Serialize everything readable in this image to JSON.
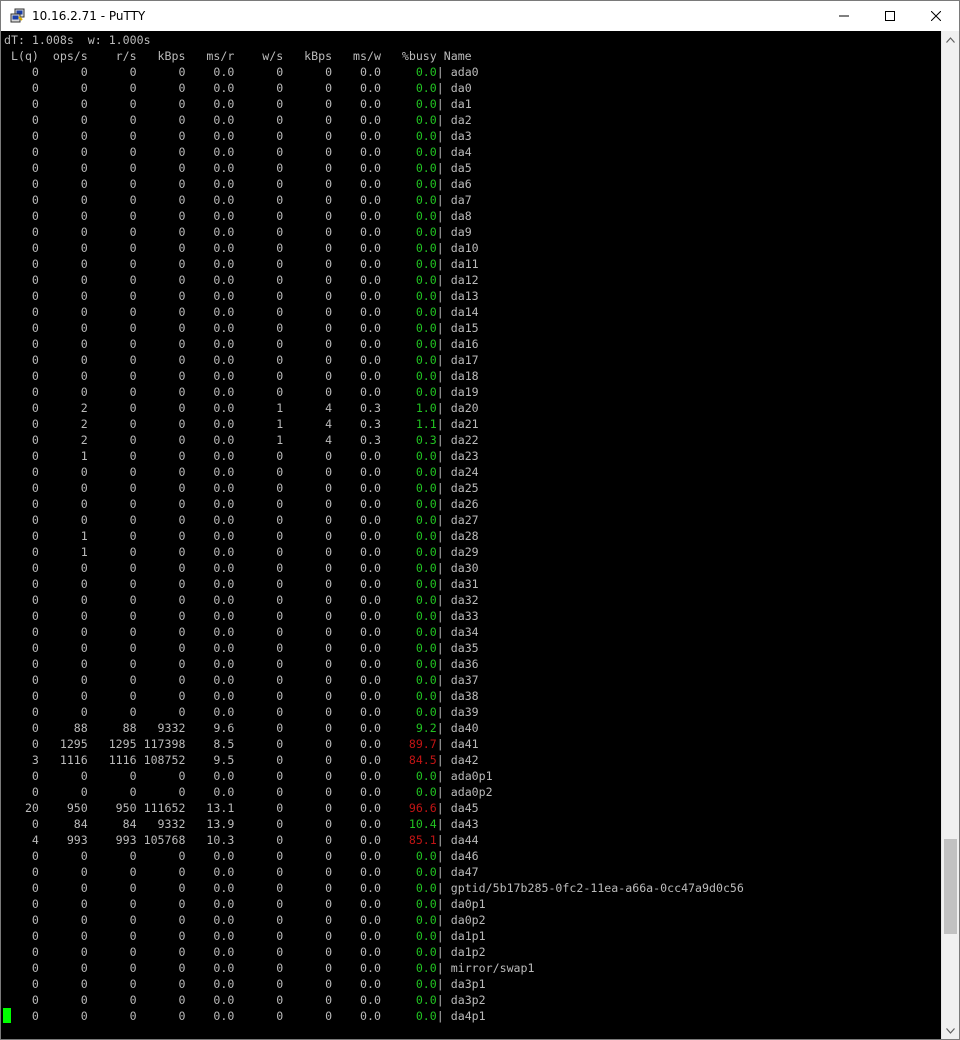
{
  "window": {
    "title": "10.16.2.71 - PuTTY",
    "icon": "putty-icon",
    "controls": [
      "minimize-icon",
      "maximize-icon",
      "close-icon"
    ]
  },
  "terminal": {
    "status_line": "dT: 1.008s  w: 1.000s",
    "columns": [
      "L(q)",
      "ops/s",
      "r/s",
      "kBps",
      "ms/r",
      "w/s",
      "kBps",
      "ms/w",
      "%busy",
      "Name"
    ],
    "colors": {
      "background": "#000000",
      "text": "#bbbbbb",
      "busy_low": "#22c322",
      "busy_high": "#c21414",
      "cursor": "#00ff00"
    },
    "rows": [
      [
        "0",
        "0",
        "0",
        "0",
        "0.0",
        "0",
        "0",
        "0.0",
        "0.0",
        "ada0"
      ],
      [
        "0",
        "0",
        "0",
        "0",
        "0.0",
        "0",
        "0",
        "0.0",
        "0.0",
        "da0"
      ],
      [
        "0",
        "0",
        "0",
        "0",
        "0.0",
        "0",
        "0",
        "0.0",
        "0.0",
        "da1"
      ],
      [
        "0",
        "0",
        "0",
        "0",
        "0.0",
        "0",
        "0",
        "0.0",
        "0.0",
        "da2"
      ],
      [
        "0",
        "0",
        "0",
        "0",
        "0.0",
        "0",
        "0",
        "0.0",
        "0.0",
        "da3"
      ],
      [
        "0",
        "0",
        "0",
        "0",
        "0.0",
        "0",
        "0",
        "0.0",
        "0.0",
        "da4"
      ],
      [
        "0",
        "0",
        "0",
        "0",
        "0.0",
        "0",
        "0",
        "0.0",
        "0.0",
        "da5"
      ],
      [
        "0",
        "0",
        "0",
        "0",
        "0.0",
        "0",
        "0",
        "0.0",
        "0.0",
        "da6"
      ],
      [
        "0",
        "0",
        "0",
        "0",
        "0.0",
        "0",
        "0",
        "0.0",
        "0.0",
        "da7"
      ],
      [
        "0",
        "0",
        "0",
        "0",
        "0.0",
        "0",
        "0",
        "0.0",
        "0.0",
        "da8"
      ],
      [
        "0",
        "0",
        "0",
        "0",
        "0.0",
        "0",
        "0",
        "0.0",
        "0.0",
        "da9"
      ],
      [
        "0",
        "0",
        "0",
        "0",
        "0.0",
        "0",
        "0",
        "0.0",
        "0.0",
        "da10"
      ],
      [
        "0",
        "0",
        "0",
        "0",
        "0.0",
        "0",
        "0",
        "0.0",
        "0.0",
        "da11"
      ],
      [
        "0",
        "0",
        "0",
        "0",
        "0.0",
        "0",
        "0",
        "0.0",
        "0.0",
        "da12"
      ],
      [
        "0",
        "0",
        "0",
        "0",
        "0.0",
        "0",
        "0",
        "0.0",
        "0.0",
        "da13"
      ],
      [
        "0",
        "0",
        "0",
        "0",
        "0.0",
        "0",
        "0",
        "0.0",
        "0.0",
        "da14"
      ],
      [
        "0",
        "0",
        "0",
        "0",
        "0.0",
        "0",
        "0",
        "0.0",
        "0.0",
        "da15"
      ],
      [
        "0",
        "0",
        "0",
        "0",
        "0.0",
        "0",
        "0",
        "0.0",
        "0.0",
        "da16"
      ],
      [
        "0",
        "0",
        "0",
        "0",
        "0.0",
        "0",
        "0",
        "0.0",
        "0.0",
        "da17"
      ],
      [
        "0",
        "0",
        "0",
        "0",
        "0.0",
        "0",
        "0",
        "0.0",
        "0.0",
        "da18"
      ],
      [
        "0",
        "0",
        "0",
        "0",
        "0.0",
        "0",
        "0",
        "0.0",
        "0.0",
        "da19"
      ],
      [
        "0",
        "2",
        "0",
        "0",
        "0.0",
        "1",
        "4",
        "0.3",
        "1.0",
        "da20"
      ],
      [
        "0",
        "2",
        "0",
        "0",
        "0.0",
        "1",
        "4",
        "0.3",
        "1.1",
        "da21"
      ],
      [
        "0",
        "2",
        "0",
        "0",
        "0.0",
        "1",
        "4",
        "0.3",
        "0.3",
        "da22"
      ],
      [
        "0",
        "1",
        "0",
        "0",
        "0.0",
        "0",
        "0",
        "0.0",
        "0.0",
        "da23"
      ],
      [
        "0",
        "0",
        "0",
        "0",
        "0.0",
        "0",
        "0",
        "0.0",
        "0.0",
        "da24"
      ],
      [
        "0",
        "0",
        "0",
        "0",
        "0.0",
        "0",
        "0",
        "0.0",
        "0.0",
        "da25"
      ],
      [
        "0",
        "0",
        "0",
        "0",
        "0.0",
        "0",
        "0",
        "0.0",
        "0.0",
        "da26"
      ],
      [
        "0",
        "0",
        "0",
        "0",
        "0.0",
        "0",
        "0",
        "0.0",
        "0.0",
        "da27"
      ],
      [
        "0",
        "1",
        "0",
        "0",
        "0.0",
        "0",
        "0",
        "0.0",
        "0.0",
        "da28"
      ],
      [
        "0",
        "1",
        "0",
        "0",
        "0.0",
        "0",
        "0",
        "0.0",
        "0.0",
        "da29"
      ],
      [
        "0",
        "0",
        "0",
        "0",
        "0.0",
        "0",
        "0",
        "0.0",
        "0.0",
        "da30"
      ],
      [
        "0",
        "0",
        "0",
        "0",
        "0.0",
        "0",
        "0",
        "0.0",
        "0.0",
        "da31"
      ],
      [
        "0",
        "0",
        "0",
        "0",
        "0.0",
        "0",
        "0",
        "0.0",
        "0.0",
        "da32"
      ],
      [
        "0",
        "0",
        "0",
        "0",
        "0.0",
        "0",
        "0",
        "0.0",
        "0.0",
        "da33"
      ],
      [
        "0",
        "0",
        "0",
        "0",
        "0.0",
        "0",
        "0",
        "0.0",
        "0.0",
        "da34"
      ],
      [
        "0",
        "0",
        "0",
        "0",
        "0.0",
        "0",
        "0",
        "0.0",
        "0.0",
        "da35"
      ],
      [
        "0",
        "0",
        "0",
        "0",
        "0.0",
        "0",
        "0",
        "0.0",
        "0.0",
        "da36"
      ],
      [
        "0",
        "0",
        "0",
        "0",
        "0.0",
        "0",
        "0",
        "0.0",
        "0.0",
        "da37"
      ],
      [
        "0",
        "0",
        "0",
        "0",
        "0.0",
        "0",
        "0",
        "0.0",
        "0.0",
        "da38"
      ],
      [
        "0",
        "0",
        "0",
        "0",
        "0.0",
        "0",
        "0",
        "0.0",
        "0.0",
        "da39"
      ],
      [
        "0",
        "88",
        "88",
        "9332",
        "9.6",
        "0",
        "0",
        "0.0",
        "9.2",
        "da40"
      ],
      [
        "0",
        "1295",
        "1295",
        "117398",
        "8.5",
        "0",
        "0",
        "0.0",
        "89.7",
        "da41"
      ],
      [
        "3",
        "1116",
        "1116",
        "108752",
        "9.5",
        "0",
        "0",
        "0.0",
        "84.5",
        "da42"
      ],
      [
        "0",
        "0",
        "0",
        "0",
        "0.0",
        "0",
        "0",
        "0.0",
        "0.0",
        "ada0p1"
      ],
      [
        "0",
        "0",
        "0",
        "0",
        "0.0",
        "0",
        "0",
        "0.0",
        "0.0",
        "ada0p2"
      ],
      [
        "20",
        "950",
        "950",
        "111652",
        "13.1",
        "0",
        "0",
        "0.0",
        "96.6",
        "da45"
      ],
      [
        "0",
        "84",
        "84",
        "9332",
        "13.9",
        "0",
        "0",
        "0.0",
        "10.4",
        "da43"
      ],
      [
        "4",
        "993",
        "993",
        "105768",
        "10.3",
        "0",
        "0",
        "0.0",
        "85.1",
        "da44"
      ],
      [
        "0",
        "0",
        "0",
        "0",
        "0.0",
        "0",
        "0",
        "0.0",
        "0.0",
        "da46"
      ],
      [
        "0",
        "0",
        "0",
        "0",
        "0.0",
        "0",
        "0",
        "0.0",
        "0.0",
        "da47"
      ],
      [
        "0",
        "0",
        "0",
        "0",
        "0.0",
        "0",
        "0",
        "0.0",
        "0.0",
        "gptid/5b17b285-0fc2-11ea-a66a-0cc47a9d0c56"
      ],
      [
        "0",
        "0",
        "0",
        "0",
        "0.0",
        "0",
        "0",
        "0.0",
        "0.0",
        "da0p1"
      ],
      [
        "0",
        "0",
        "0",
        "0",
        "0.0",
        "0",
        "0",
        "0.0",
        "0.0",
        "da0p2"
      ],
      [
        "0",
        "0",
        "0",
        "0",
        "0.0",
        "0",
        "0",
        "0.0",
        "0.0",
        "da1p1"
      ],
      [
        "0",
        "0",
        "0",
        "0",
        "0.0",
        "0",
        "0",
        "0.0",
        "0.0",
        "da1p2"
      ],
      [
        "0",
        "0",
        "0",
        "0",
        "0.0",
        "0",
        "0",
        "0.0",
        "0.0",
        "mirror/swap1"
      ],
      [
        "0",
        "0",
        "0",
        "0",
        "0.0",
        "0",
        "0",
        "0.0",
        "0.0",
        "da3p1"
      ],
      [
        "0",
        "0",
        "0",
        "0",
        "0.0",
        "0",
        "0",
        "0.0",
        "0.0",
        "da3p2"
      ],
      [
        "0",
        "0",
        "0",
        "0",
        "0.0",
        "0",
        "0",
        "0.0",
        "0.0",
        "da4p1"
      ]
    ]
  },
  "scrollbar": {
    "up_icon": "scroll-up-arrow-icon",
    "down_icon": "scroll-down-arrow-icon",
    "position_fraction": 0.9
  }
}
